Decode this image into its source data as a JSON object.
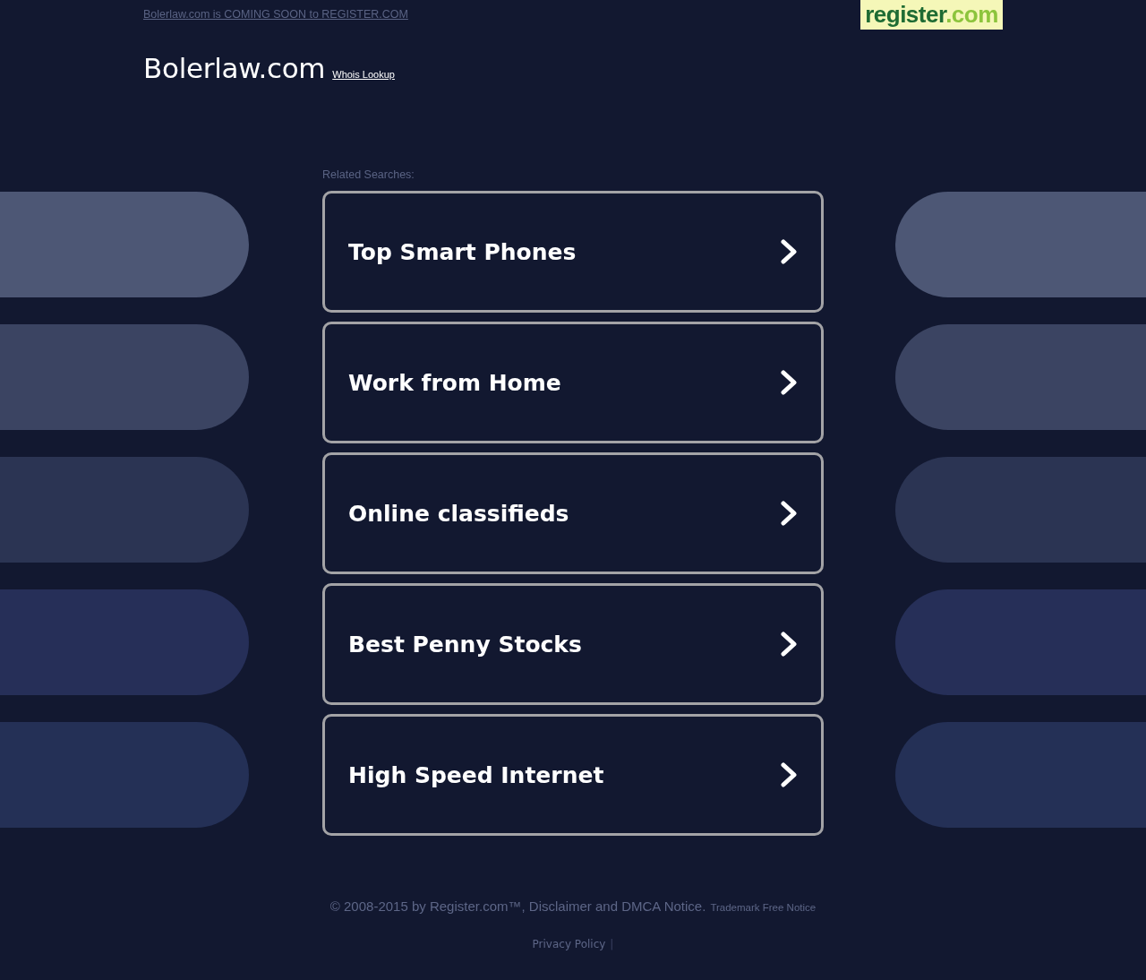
{
  "top_bar": {
    "notice_link": "Bolerlaw.com is COMING SOON to REGISTER.COM",
    "logo": {
      "name": "register",
      "suffix": ".com"
    }
  },
  "header": {
    "domain": "Bolerlaw.com",
    "whois_link": "Whois Lookup"
  },
  "related_searches": {
    "label": "Related Searches:",
    "links": [
      "Top Smart Phones",
      "Work from Home",
      "Online classifieds",
      "Best Penny Stocks",
      "High Speed Internet"
    ]
  },
  "footer": {
    "copyright": "© 2008-2015 by Register.com™, Disclaimer and DMCA Notice.",
    "trademark_link": "Trademark Free Notice",
    "privacy_link": "Privacy Policy",
    "separator": "|"
  }
}
